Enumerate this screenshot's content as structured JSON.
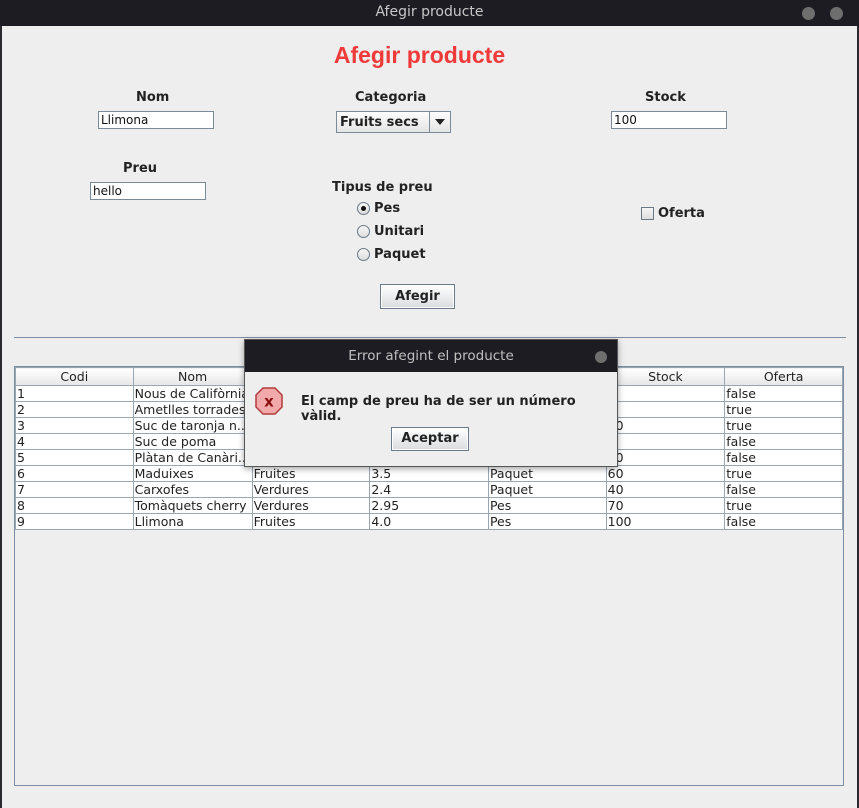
{
  "window": {
    "title": "Afegir producte"
  },
  "form": {
    "heading": "Afegir producte",
    "nom_label": "Nom",
    "nom_value": "Llimona",
    "categoria_label": "Categoria",
    "categoria_selected": "Fruits secs",
    "stock_label": "Stock",
    "stock_value": "100",
    "preu_label": "Preu",
    "preu_value": "hello",
    "tipus_label": "Tipus de preu",
    "radios": [
      {
        "label": "Pes",
        "checked": true
      },
      {
        "label": "Unitari",
        "checked": false
      },
      {
        "label": "Paquet",
        "checked": false
      }
    ],
    "oferta_label": "Oferta",
    "oferta_checked": false,
    "submit_label": "Afegir"
  },
  "table": {
    "columns": [
      "Codi",
      "Nom",
      "",
      "",
      "",
      "Stock",
      "Oferta"
    ],
    "rows": [
      [
        "1",
        "Nous de Califòrnia",
        "",
        "",
        "",
        "0",
        "false"
      ],
      [
        "2",
        "Ametlles torrades",
        "",
        "",
        "",
        "0",
        "true"
      ],
      [
        "3",
        "Suc de taronja n...",
        "",
        "",
        "",
        "00",
        "true"
      ],
      [
        "4",
        "Suc de poma",
        "",
        "",
        "",
        "0",
        "false"
      ],
      [
        "5",
        "Plàtan de Canàri...",
        "",
        "",
        "",
        "20",
        "false"
      ],
      [
        "6",
        "Maduixes",
        "Fruites",
        "3.5",
        "Paquet",
        "60",
        "true"
      ],
      [
        "7",
        "Carxofes",
        "Verdures",
        "2.4",
        "Paquet",
        "40",
        "false"
      ],
      [
        "8",
        "Tomàquets cherry",
        "Verdures",
        "2.95",
        "Pes",
        "70",
        "true"
      ],
      [
        "9",
        "Llimona",
        "Fruites",
        "4.0",
        "Pes",
        "100",
        "false"
      ]
    ]
  },
  "dialog": {
    "title": "Error afegint el producte",
    "icon_text": "x",
    "message": "El camp de preu ha de ser un número vàlid.",
    "button_label": "Aceptar"
  },
  "colors": {
    "heading": "#f03a3a",
    "titlebar": "#1d1c22",
    "background": "#eeeeee"
  }
}
